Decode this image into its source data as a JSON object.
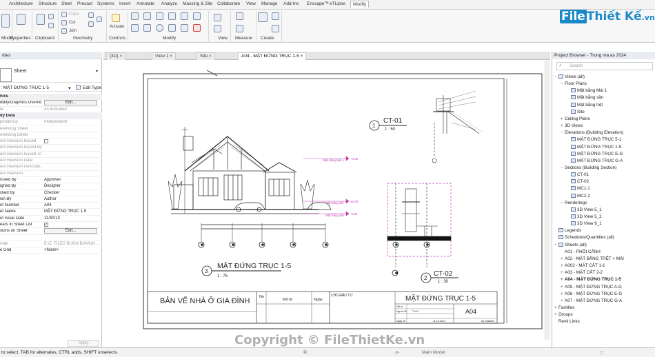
{
  "ribbon": {
    "tabs": [
      "Architecture",
      "Structure",
      "Steel",
      "Precast",
      "Systems",
      "Insert",
      "Annotate",
      "Analyze",
      "Massing & Site",
      "Collaborate",
      "View",
      "Manage",
      "Add-Ins",
      "Enscape™",
      "eTLipse",
      "Modify"
    ],
    "panels": {
      "modify": "Modify",
      "properties": "Properties",
      "clipboard": "Clipboard",
      "geometry": "Geometry",
      "controls": "Controls",
      "modify2": "Modify",
      "view": "View",
      "measure": "Measure",
      "create": "Create"
    },
    "small": {
      "cope": "Cope",
      "cut": "Cut",
      "join": "Join",
      "activate": "Activate"
    }
  },
  "logo": {
    "main": "File",
    "rest": "Thiết Kế",
    "suffix": ".vn"
  },
  "properties": {
    "title": "rties",
    "type_name": "Sheet",
    "selector": ": MẶT ĐỨNG TRỤC 1-5",
    "edit_type": "Edit Type",
    "rows": [
      {
        "k": "hics",
        "v": "",
        "kind": "head"
      },
      {
        "k": "ibility/Graphics Overrid...",
        "v": "Edit...",
        "kind": "button"
      },
      {
        "k": "le",
        "v": "As indicated",
        "kind": "dim"
      },
      {
        "k": "ity Data",
        "v": "",
        "kind": "head"
      },
      {
        "k": "pendency",
        "v": "Independent",
        "kind": "dim"
      },
      {
        "k": "erencing Sheet",
        "v": "",
        "kind": "dim"
      },
      {
        "k": "erencing Detail",
        "v": "",
        "kind": "dim"
      },
      {
        "k": "ent Revision Issued",
        "v": "",
        "kind": "check-dim"
      },
      {
        "k": "ent Revision Issued By",
        "v": "",
        "kind": "dim"
      },
      {
        "k": "ent Revision Issued To",
        "v": "",
        "kind": "dim"
      },
      {
        "k": "ent Revision Date",
        "v": "",
        "kind": "dim"
      },
      {
        "k": "ent Revision Descripti...",
        "v": "",
        "kind": "dim"
      },
      {
        "k": "ent Revision",
        "v": "",
        "kind": "dim"
      },
      {
        "k": "roved By",
        "v": "Approver",
        "kind": ""
      },
      {
        "k": "igned By",
        "v": "Designer",
        "kind": ""
      },
      {
        "k": "cked By",
        "v": "Checker",
        "kind": ""
      },
      {
        "k": "wn By",
        "v": "Author",
        "kind": ""
      },
      {
        "k": "et Number",
        "v": "A04",
        "kind": ""
      },
      {
        "k": "et Name",
        "v": "MẶT ĐỨNG TRỤC 1-5",
        "kind": ""
      },
      {
        "k": "et Issue Date",
        "v": "11/30/13",
        "kind": ""
      },
      {
        "k": "ears In Sheet List",
        "v": "",
        "kind": "check"
      },
      {
        "k": "sions on Sheet",
        "v": "Edit...",
        "kind": "button"
      },
      {
        "k": "",
        "v": "",
        "kind": ""
      },
      {
        "k": "Path",
        "v": "E:\\Z. FILES BUON BAN\\NH...",
        "kind": "dim"
      },
      {
        "k": "e Grid",
        "v": "<None>",
        "kind": ""
      }
    ],
    "apply": "Apply"
  },
  "view_tabs": [
    "{3D}",
    "View 1",
    "Site",
    "A04 - MẶT ĐỨNG TRỤC 1-5"
  ],
  "sheet": {
    "main_view_title": "MẶT ĐỨNG TRỤC 1-5",
    "main_view_no": "3",
    "main_view_scale": "1 : 75",
    "ct01_title": "CT-01",
    "ct01_no": "1",
    "ct01_scale": "1 : 50",
    "ct02_title": "CT-02",
    "ct02_no": "2",
    "ct02_scale": "1 : 30",
    "level_top": "Mặt bằng Mái 1",
    "level_mid": "Mặt bằng trệt",
    "level_low": "Mặt bằng sân",
    "lv_top_val": "+4.00",
    "lv_mid_val": "±0.00",
    "lv_low_val": "-0.30",
    "tb_company": "BẢN VẼ NHÀ Ở GIA ĐÌNH",
    "tb_no": "No",
    "tb_desc": "Mô tả",
    "tb_date": "Ngày",
    "tb_owner": "CHỦ ĐẦU TƯ",
    "tb_sheet_name": "MẶT ĐỨNG TRỤC 1-5",
    "tb_sheet_no": "A04",
    "tb_issue": "11-10-2013",
    "tb_scale": "As indicated",
    "tb_code_lbl": "Mã số",
    "tb_date_lbl": "Ngày vẽ",
    "tb_drawn_lbl": "Người vẽ",
    "tb_drawn": "T-V-N"
  },
  "browser": {
    "title": "Project Browser - Trong ma as 2024",
    "search_placeholder": "Search",
    "nodes": [
      {
        "t": "Views (all)",
        "lvl": 0,
        "tw": "−",
        "icon": true
      },
      {
        "t": "Floor Plans",
        "lvl": 1,
        "tw": "−"
      },
      {
        "t": "Mặt bằng Mái 1",
        "lvl": 2,
        "icon": true
      },
      {
        "t": "Mặt bằng sân",
        "lvl": 2,
        "icon": true
      },
      {
        "t": "Mặt bằng trệt",
        "lvl": 2,
        "icon": true
      },
      {
        "t": "Site",
        "lvl": 2,
        "icon": true
      },
      {
        "t": "Ceiling Plans",
        "lvl": 1,
        "tw": "+"
      },
      {
        "t": "3D Views",
        "lvl": 1,
        "tw": "+"
      },
      {
        "t": "Elevations (Building Elevation)",
        "lvl": 1,
        "tw": "−"
      },
      {
        "t": "MẶT ĐỨNG TRỤC 5-1",
        "lvl": 2,
        "icon": true
      },
      {
        "t": "MẶT ĐỨNG TRỤC 1-5",
        "lvl": 2,
        "icon": true
      },
      {
        "t": "MẶT ĐỨNG TRỤC E-G",
        "lvl": 2,
        "icon": true
      },
      {
        "t": "MẶT ĐỨNG TRỤC G-A",
        "lvl": 2,
        "icon": true
      },
      {
        "t": "Sections (Building Section)",
        "lvl": 1,
        "tw": "−"
      },
      {
        "t": "CT-01",
        "lvl": 2,
        "icon": true
      },
      {
        "t": "CT-02",
        "lvl": 2,
        "icon": true
      },
      {
        "t": "MC1-1",
        "lvl": 2,
        "icon": true
      },
      {
        "t": "MC2-2",
        "lvl": 2,
        "icon": true
      },
      {
        "t": "Renderings",
        "lvl": 1,
        "tw": "−"
      },
      {
        "t": "3D View 5_1",
        "lvl": 2,
        "icon": true
      },
      {
        "t": "3D View 5_2",
        "lvl": 2,
        "icon": true
      },
      {
        "t": "3D View 9_1",
        "lvl": 2,
        "icon": true
      },
      {
        "t": "Legends",
        "lvl": 0,
        "icon": true
      },
      {
        "t": "Schedules/Quantities (all)",
        "lvl": 0,
        "icon": true
      },
      {
        "t": "Sheets (all)",
        "lvl": 0,
        "tw": "−",
        "icon": true
      },
      {
        "t": "A01 - PHỐI CẢNH",
        "lvl": 1
      },
      {
        "t": "A02 - MẶT BẰNG TRỆT + MÁI",
        "lvl": 1,
        "tw": "+"
      },
      {
        "t": "A002 - MẶT CẮT 1-1",
        "lvl": 1,
        "tw": "+"
      },
      {
        "t": "A03 - MẶT CẮT 2-2",
        "lvl": 1,
        "tw": "+"
      },
      {
        "t": "A04 - MẶT ĐỨNG TRỤC 1-5",
        "lvl": 1,
        "tw": "+",
        "hl": true
      },
      {
        "t": "A05 - MẶT ĐỨNG TRỤC A-G",
        "lvl": 1,
        "tw": "+"
      },
      {
        "t": "A06 - MẶT ĐỨNG TRỤC E-G",
        "lvl": 1,
        "tw": "+"
      },
      {
        "t": "A07 - MẶT ĐỨNG TRỤC G-A",
        "lvl": 1,
        "tw": "+"
      },
      {
        "t": "Families",
        "lvl": 0,
        "tw": "+"
      },
      {
        "t": "Groups",
        "lvl": 0,
        "tw": "+"
      },
      {
        "t": "Revit Links",
        "lvl": 0
      }
    ]
  },
  "status": {
    "message": "to select, TAB for alternates, CTRL adds, SHIFT unselects.",
    "model": "Main Model"
  },
  "copyright": "Copyright © FileThietKe.vn"
}
